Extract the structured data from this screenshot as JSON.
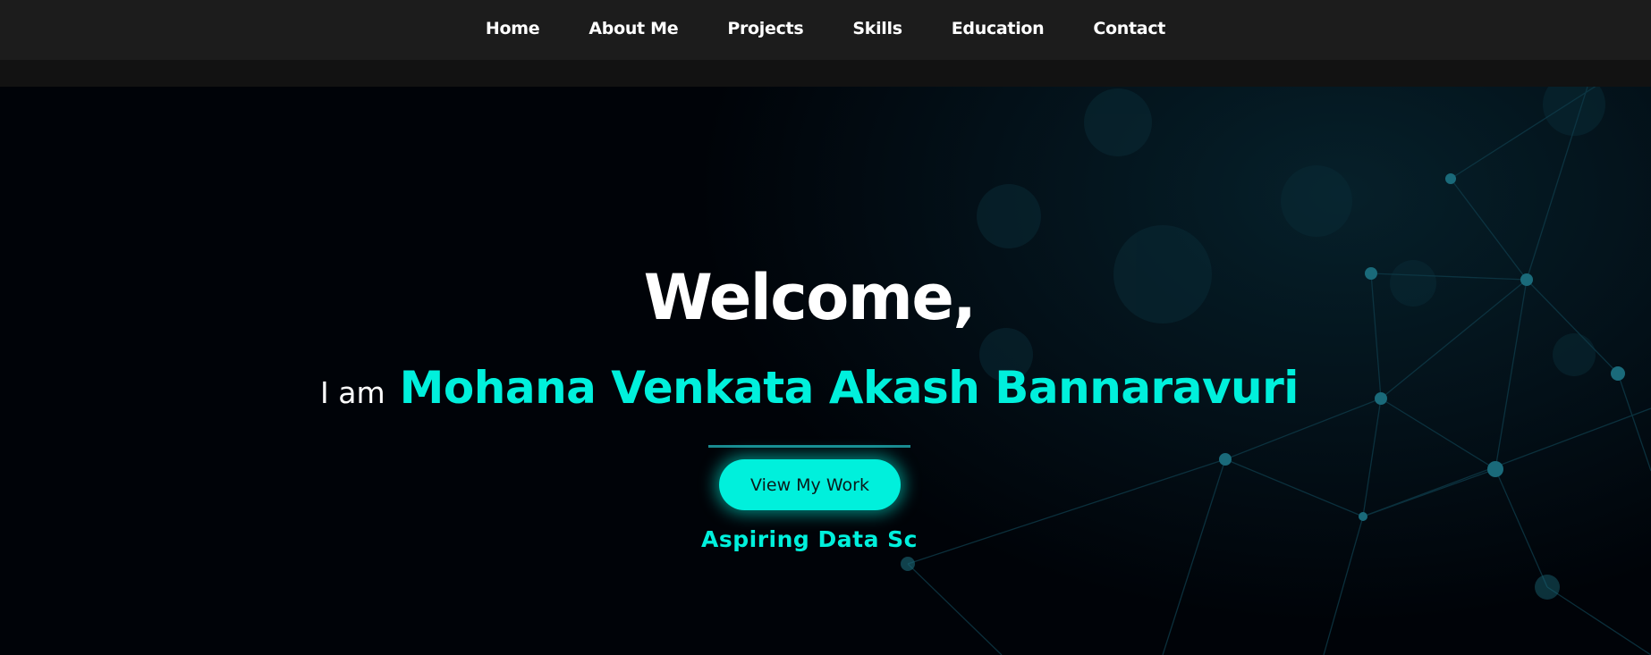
{
  "nav": {
    "items": [
      {
        "label": "Home"
      },
      {
        "label": "About Me"
      },
      {
        "label": "Projects"
      },
      {
        "label": "Skills"
      },
      {
        "label": "Education"
      },
      {
        "label": "Contact"
      }
    ]
  },
  "hero": {
    "welcome": "Welcome,",
    "intro": "I am",
    "name": "Mohana Venkata Akash Bannaravuri",
    "cta_label": "View My Work",
    "subtitle": "Aspiring Data Sc"
  },
  "colors": {
    "accent": "#00f0dc",
    "nav_bg": "#1c1c1c",
    "page_bg": "#000308",
    "text": "#ffffff"
  }
}
